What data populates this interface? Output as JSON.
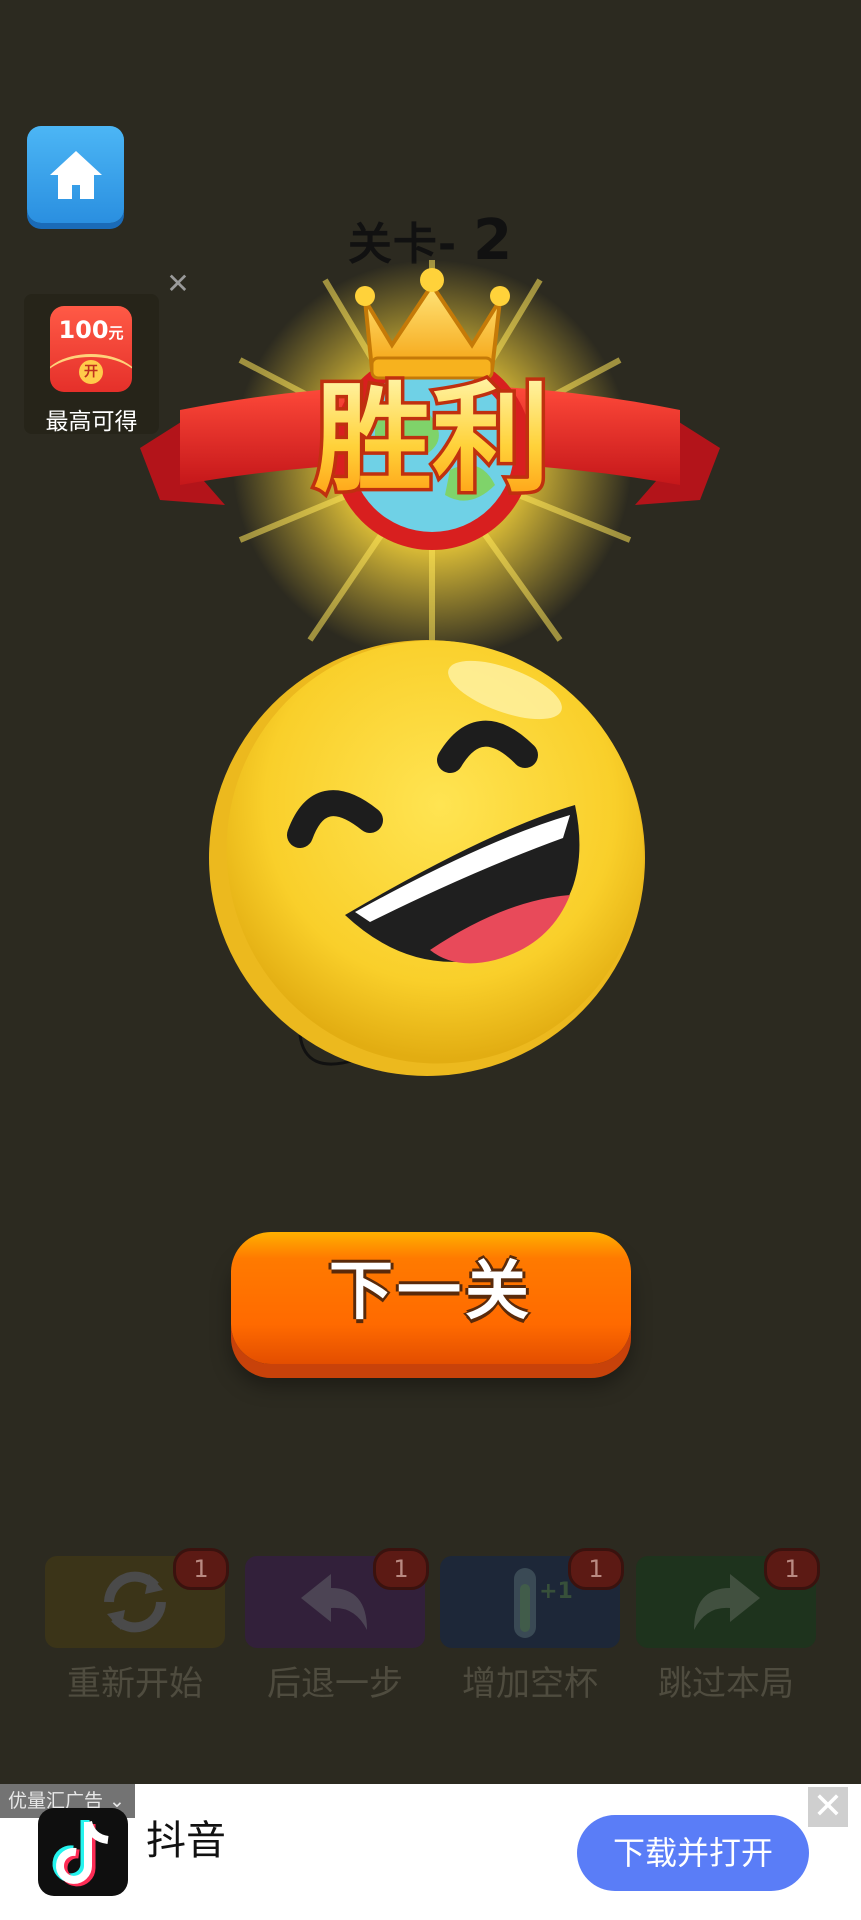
{
  "header": {
    "home_icon": "home-icon",
    "level_prefix": "关卡-",
    "level_number": "2"
  },
  "promo": {
    "amount": "100",
    "unit": "元",
    "open_text": "开",
    "caption": "最高可得",
    "close_symbol": "✕"
  },
  "victory": {
    "banner_text": "胜利",
    "icon": "crown-globe-badge",
    "emoji": "laughing-face"
  },
  "next_button": {
    "label": "下一关"
  },
  "tools": [
    {
      "label": "重新开始",
      "count": "1",
      "icon": "refresh-icon",
      "color": "#3b3418"
    },
    {
      "label": "后退一步",
      "count": "1",
      "icon": "undo-arrow-icon",
      "color": "#32203a"
    },
    {
      "label": "增加空杯",
      "count": "1",
      "icon": "test-tube-plus-icon",
      "color": "#1d2738"
    },
    {
      "label": "跳过本局",
      "count": "1",
      "icon": "redo-arrow-icon",
      "color": "#1e331d"
    }
  ],
  "ad": {
    "tag": "优量汇广告",
    "app_name": "抖音",
    "button_label": "下载并打开",
    "close_symbol": "✕",
    "accent": "#5a7df7"
  }
}
